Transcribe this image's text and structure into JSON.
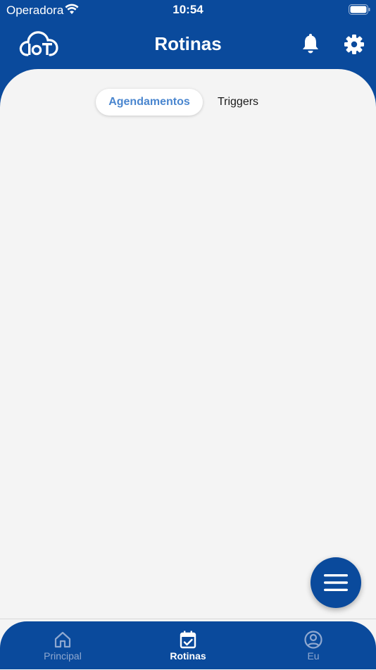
{
  "status_bar": {
    "carrier": "Operadora",
    "time": "10:54"
  },
  "header": {
    "title": "Rotinas",
    "logo_icon": "iot-cloud-icon",
    "actions": [
      "bell-icon",
      "gear-icon"
    ]
  },
  "segments": {
    "active": "Agendamentos",
    "inactive": "Triggers"
  },
  "fab": {
    "icon": "menu-icon"
  },
  "tabs": [
    {
      "label": "Principal",
      "icon": "home-icon",
      "active": false
    },
    {
      "label": "Rotinas",
      "icon": "calendar-check-icon",
      "active": true
    },
    {
      "label": "Eu",
      "icon": "user-circle-icon",
      "active": false
    }
  ],
  "colors": {
    "primary": "#0a4a9c",
    "accent": "#4a86cf",
    "background": "#f4f4f4",
    "tab_inactive": "#8fa8d0"
  }
}
